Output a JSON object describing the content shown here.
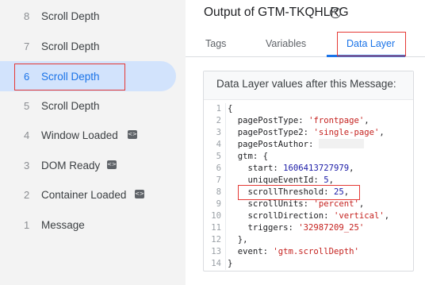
{
  "sidebar": {
    "items": [
      {
        "num": "8",
        "label": "Scroll Depth",
        "tag": ""
      },
      {
        "num": "7",
        "label": "Scroll Depth",
        "tag": ""
      },
      {
        "num": "6",
        "label": "Scroll Depth",
        "tag": ""
      },
      {
        "num": "5",
        "label": "Scroll Depth",
        "tag": ""
      },
      {
        "num": "4",
        "label": "Window Loaded",
        "tag": "<>"
      },
      {
        "num": "3",
        "label": "DOM Ready",
        "tag": "<>"
      },
      {
        "num": "2",
        "label": "Container Loaded",
        "tag": "<>"
      },
      {
        "num": "1",
        "label": "Message",
        "tag": ""
      }
    ],
    "active_index": 2
  },
  "panel": {
    "title": "Output of GTM-TKQHLRG",
    "tabs": [
      {
        "label": "Tags"
      },
      {
        "label": "Variables"
      },
      {
        "label": "Data Layer"
      }
    ],
    "active_tab": "Data Layer"
  },
  "card": {
    "heading": "Data Layer values after this Message:",
    "lines": [
      {
        "n": "1",
        "key": "{",
        "val": ""
      },
      {
        "n": "2",
        "key": "  pagePostType: ",
        "val": "'frontpage'",
        "tail": ","
      },
      {
        "n": "3",
        "key": "  pagePostType2: ",
        "val": "'single-page'",
        "tail": ","
      },
      {
        "n": "4",
        "key": "  pagePostAuthor: ",
        "val": "",
        "tail": ""
      },
      {
        "n": "5",
        "key": "  gtm: {",
        "val": ""
      },
      {
        "n": "6",
        "key": "    start: ",
        "val": "1606413727979",
        "tail": ","
      },
      {
        "n": "7",
        "key": "    uniqueEventId: ",
        "val": "5",
        "tail": ","
      },
      {
        "n": "8",
        "key": "    scrollThreshold: ",
        "val": "25",
        "tail": ","
      },
      {
        "n": "9",
        "key": "    scrollUnits: ",
        "val": "'percent'",
        "tail": ","
      },
      {
        "n": "10",
        "key": "    scrollDirection: ",
        "val": "'vertical'",
        "tail": ","
      },
      {
        "n": "11",
        "key": "    triggers: ",
        "val": "'32987209_25'",
        "tail": ""
      },
      {
        "n": "12",
        "key": "  },",
        "val": ""
      },
      {
        "n": "13",
        "key": "  event: ",
        "val": "'gtm.scrollDepth'",
        "tail": ""
      },
      {
        "n": "14",
        "key": "}",
        "val": ""
      }
    ]
  },
  "colors": {
    "accent": "#1a73e8",
    "highlight_border": "#e53935",
    "string": "#c5221f",
    "number": "#1a1aa6"
  }
}
